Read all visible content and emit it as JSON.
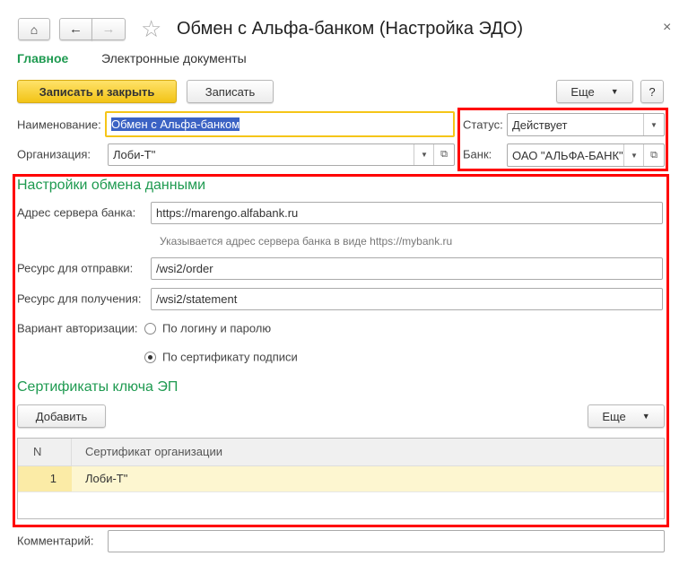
{
  "window": {
    "title": "Обмен с Альфа-банком (Настройка ЭДО)",
    "close": "×"
  },
  "tabs": [
    {
      "label": "Главное",
      "active": true
    },
    {
      "label": "Электронные документы"
    }
  ],
  "toolbar": {
    "save_close": "Записать и закрыть",
    "save": "Записать",
    "more": "Еще",
    "help": "?"
  },
  "fields": {
    "name": {
      "label": "Наименование:",
      "value": "Обмен с Альфа-банком"
    },
    "org": {
      "label": "Организация:",
      "value": "Лоби-Т\""
    },
    "status": {
      "label": "Статус:",
      "value": "Действует"
    },
    "bank": {
      "label": "Банк:",
      "value": "ОАО \"АЛЬФА-БАНК\""
    },
    "comment": {
      "label": "Комментарий:",
      "value": ""
    }
  },
  "exchange": {
    "title": "Настройки обмена данными",
    "server": {
      "label": "Адрес сервера банка:",
      "value": "https://marengo.alfabank.ru",
      "hint": "Указывается адрес сервера банка в виде https://mybank.ru"
    },
    "send": {
      "label": "Ресурс для отправки:",
      "value": "/wsi2/order"
    },
    "receive": {
      "label": "Ресурс для получения:",
      "value": "/wsi2/statement"
    },
    "auth": {
      "label": "Вариант авторизации:",
      "options": [
        {
          "label": "По логину и паролю",
          "selected": false
        },
        {
          "label": "По сертификату подписи",
          "selected": true
        }
      ]
    }
  },
  "certs": {
    "title": "Сертификаты ключа ЭП",
    "add": "Добавить",
    "more": "Еще",
    "columns": [
      "N",
      "Сертификат организации"
    ],
    "rows": [
      {
        "n": "1",
        "cert": "Лоби-Т\""
      }
    ]
  },
  "colors": {
    "accent_green": "#1e9a50",
    "highlight_red": "#ff0000",
    "primary_yellow": "#f5cc2a"
  }
}
